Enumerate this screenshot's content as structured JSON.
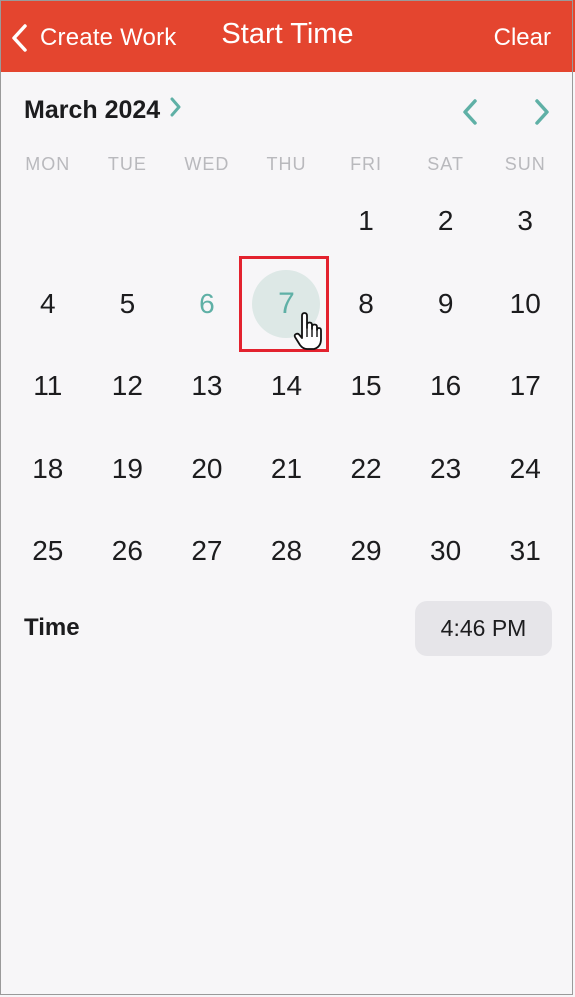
{
  "navbar": {
    "back_label": "Create Work",
    "title": "Start Time",
    "clear_label": "Clear",
    "color": "#e4452f"
  },
  "calendar": {
    "month_label": "March 2024",
    "accent_color": "#5fb0a6",
    "weekdays": [
      "MON",
      "TUE",
      "WED",
      "THU",
      "FRI",
      "SAT",
      "SUN"
    ],
    "leading_blank_days": 4,
    "days": [
      "1",
      "2",
      "3",
      "4",
      "5",
      "6",
      "7",
      "8",
      "9",
      "10",
      "11",
      "12",
      "13",
      "14",
      "15",
      "16",
      "17",
      "18",
      "19",
      "20",
      "21",
      "22",
      "23",
      "24",
      "25",
      "26",
      "27",
      "28",
      "29",
      "30",
      "31"
    ],
    "today": "6",
    "selected": "7"
  },
  "time": {
    "label": "Time",
    "value": "4:46 PM"
  }
}
